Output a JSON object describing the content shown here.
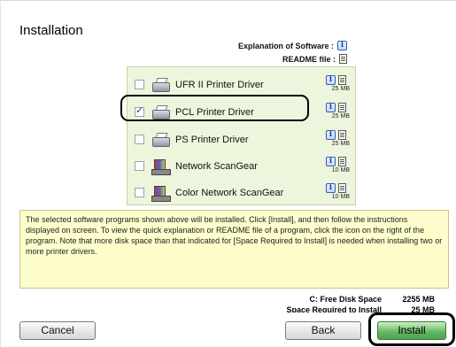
{
  "title": "Installation",
  "legend": {
    "explanation_label": "Explanation of Software :",
    "readme_label": "README file :"
  },
  "items": [
    {
      "label": "UFR II Printer Driver",
      "size": "25 MB",
      "checked": false,
      "icon": "printer"
    },
    {
      "label": "PCL Printer Driver",
      "size": "25 MB",
      "checked": true,
      "icon": "printer"
    },
    {
      "label": "PS Printer Driver",
      "size": "25 MB",
      "checked": false,
      "icon": "printer"
    },
    {
      "label": "Network ScanGear",
      "size": "10 MB",
      "checked": false,
      "icon": "scanner"
    },
    {
      "label": "Color Network ScanGear",
      "size": "10 MB",
      "checked": false,
      "icon": "scanner"
    }
  ],
  "description": "The selected software programs shown above will be installed. Click [Install], and then follow the instructions displayed on screen. To view the quick explanation or README file of a program, click the icon on the right of the program. Note that more disk space than that indicated for [Space Required to Install] is needed when installing two or more printer drivers.",
  "disk": {
    "free_label": "C: Free Disk Space",
    "free_value": "2255 MB",
    "required_label": "Space Required to Install",
    "required_value": "25 MB"
  },
  "buttons": {
    "cancel": "Cancel",
    "back": "Back",
    "install": "Install"
  }
}
